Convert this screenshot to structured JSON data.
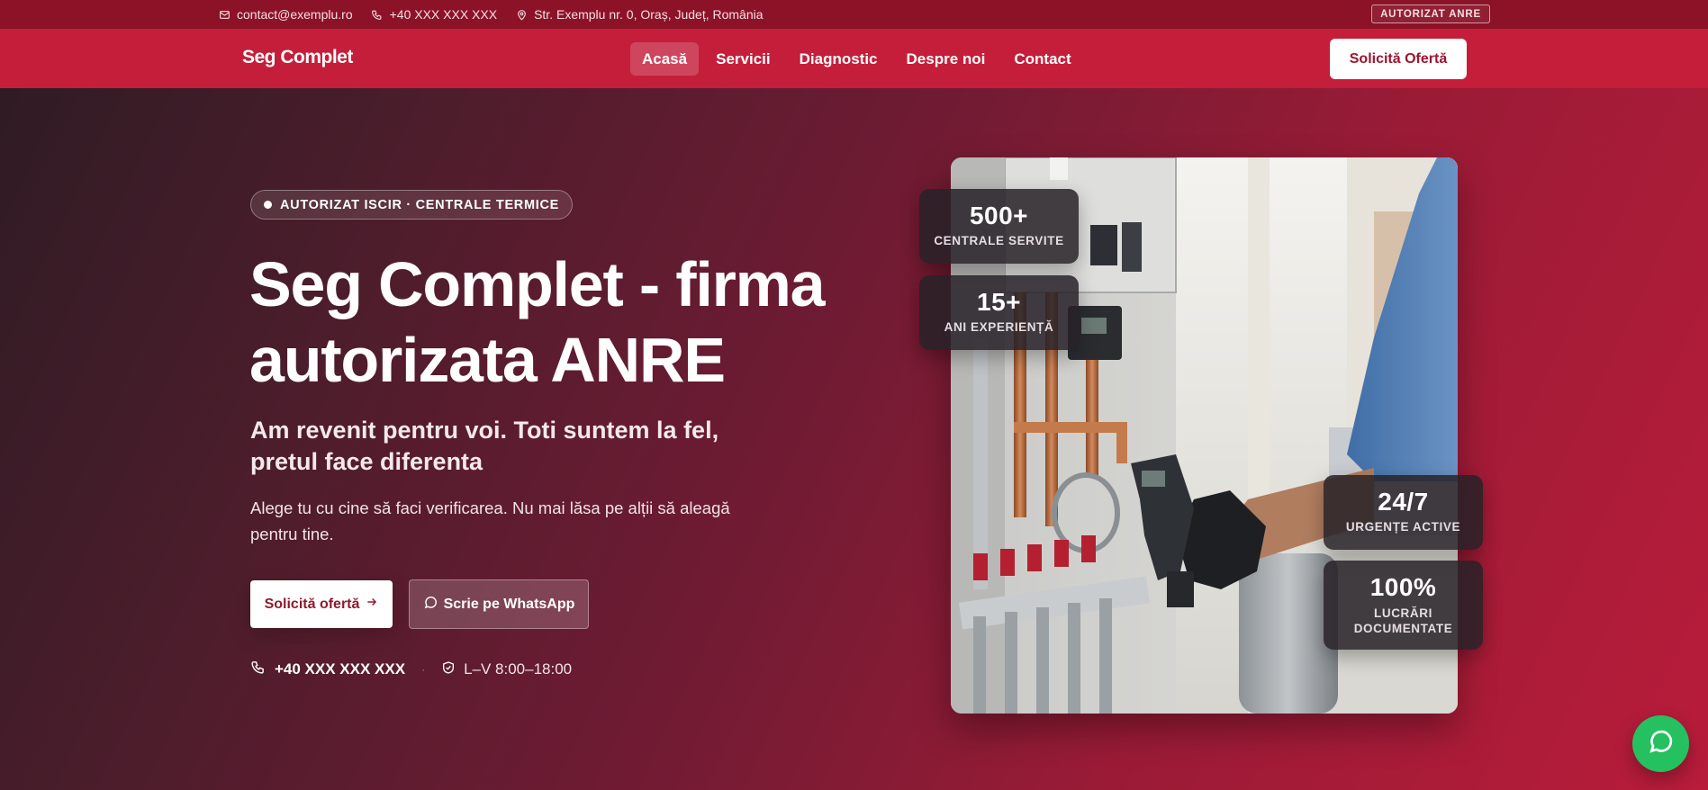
{
  "topbar": {
    "email": "contact@exemplu.ro",
    "phone": "+40 XXX XXX XXX",
    "address": "Str. Exemplu nr. 0, Oraș, Județ, România",
    "badge": "AUTORIZAT ANRE",
    "icons": [
      "mail-icon",
      "phone-icon",
      "map-pin-icon"
    ]
  },
  "nav": {
    "logo": "Seg Complet",
    "items": [
      "Acasă",
      "Servicii",
      "Diagnostic",
      "Despre noi",
      "Contact"
    ],
    "active_index": 0,
    "cta": "Solicită Ofertă"
  },
  "hero": {
    "pill": "AUTORIZAT ISCIR · CENTRALE TERMICE",
    "title": "Seg Complet - firma autorizata ANRE",
    "subtitle": "Am revenit pentru voi. Toti suntem la fel, pretul face diferenta",
    "lead": "Alege tu cu cine să faci verificarea. Nu mai lăsa pe alții să aleagă pentru tine.",
    "primary_button": "Solicită ofertă",
    "secondary_button": "Scrie pe WhatsApp",
    "phone": "+40 XXX XXX XXX",
    "hours": "L–V 8:00–18:00"
  },
  "stats": [
    {
      "value": "500+",
      "label": "CENTRALE SERVITE"
    },
    {
      "value": "15+",
      "label": "ANI EXPERIENȚĂ"
    },
    {
      "value": "24/7",
      "label": "URGENȚE ACTIVE"
    },
    {
      "value": "100%",
      "label": "LUCRĂRI DOCUMENTATE"
    }
  ],
  "colors": {
    "brand": "#c41e3a",
    "topbar": "#8c1327",
    "whatsapp": "#25c05f"
  }
}
